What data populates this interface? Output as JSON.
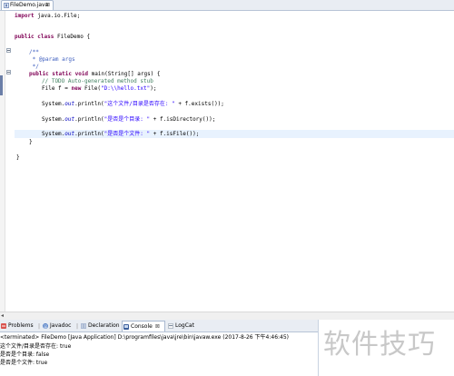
{
  "editor": {
    "tab_label": "FileDemo.java",
    "tab_close": "⊠",
    "code": {
      "l1_kw": "import",
      "l1_rest": " java.io.File;",
      "l2_kw1": "public",
      "l2_kw2": " class",
      "l2_rest": " FileDemo {",
      "l3": "/**",
      "l4": " * @param args",
      "l5": " */",
      "l6_kw1": "public",
      "l6_kw2": " static",
      "l6_kw3": " void",
      "l6_rest": " main(String[] args) {",
      "l7": "// TODO Auto-generated method stub",
      "l8_pre": "File f = ",
      "l8_kw": "new",
      "l8_mid": " File(",
      "l8_str": "\"D:\\\\hello.txt\"",
      "l8_post": ");",
      "l9_pre": "System.",
      "l9_out": "out",
      "l9_mid": ".println(",
      "l9_str": "\"这个文件/目录是否存在: \"",
      "l9_post": " + f.exists());",
      "l10_pre": "System.",
      "l10_out": "out",
      "l10_mid": ".println(",
      "l10_str": "\"是否是个目录: \"",
      "l10_post": " + f.isDirectory());",
      "l11_pre": "System.",
      "l11_out": "out",
      "l11_mid": ".println(",
      "l11_str": "\"是否是个文件: \"",
      "l11_post": " + f.isFile());",
      "l12": "}",
      "l13": "}"
    }
  },
  "panel": {
    "tabs": {
      "problems": "Problems",
      "javadoc": "Javadoc",
      "declaration": "Declaration",
      "console": "Console",
      "console_close": "⊠",
      "logcat": "LogCat"
    },
    "console": {
      "terminated": "<terminated> FileDemo [Java Application] D:\\programfiles\\java\\jre\\bin\\javaw.exe (2017-8-26 下午4:46:45)",
      "out1": "这个文件/目录是否存在: true",
      "out2": "是否是个目录: false",
      "out3": "是否是个文件: true"
    }
  },
  "watermark": "软件技巧",
  "colors": {
    "keyword": "#7f0055",
    "comment": "#3f7f5f",
    "javadoc": "#3f5fbf",
    "string": "#2a00ff",
    "field": "#0000c0",
    "current_line": "#e8f2fe"
  },
  "icons": {
    "tab": "java-file-icon",
    "problems": "problems-icon",
    "javadoc": "javadoc-icon",
    "declaration": "declaration-icon",
    "console": "console-icon",
    "logcat": "logcat-icon"
  }
}
